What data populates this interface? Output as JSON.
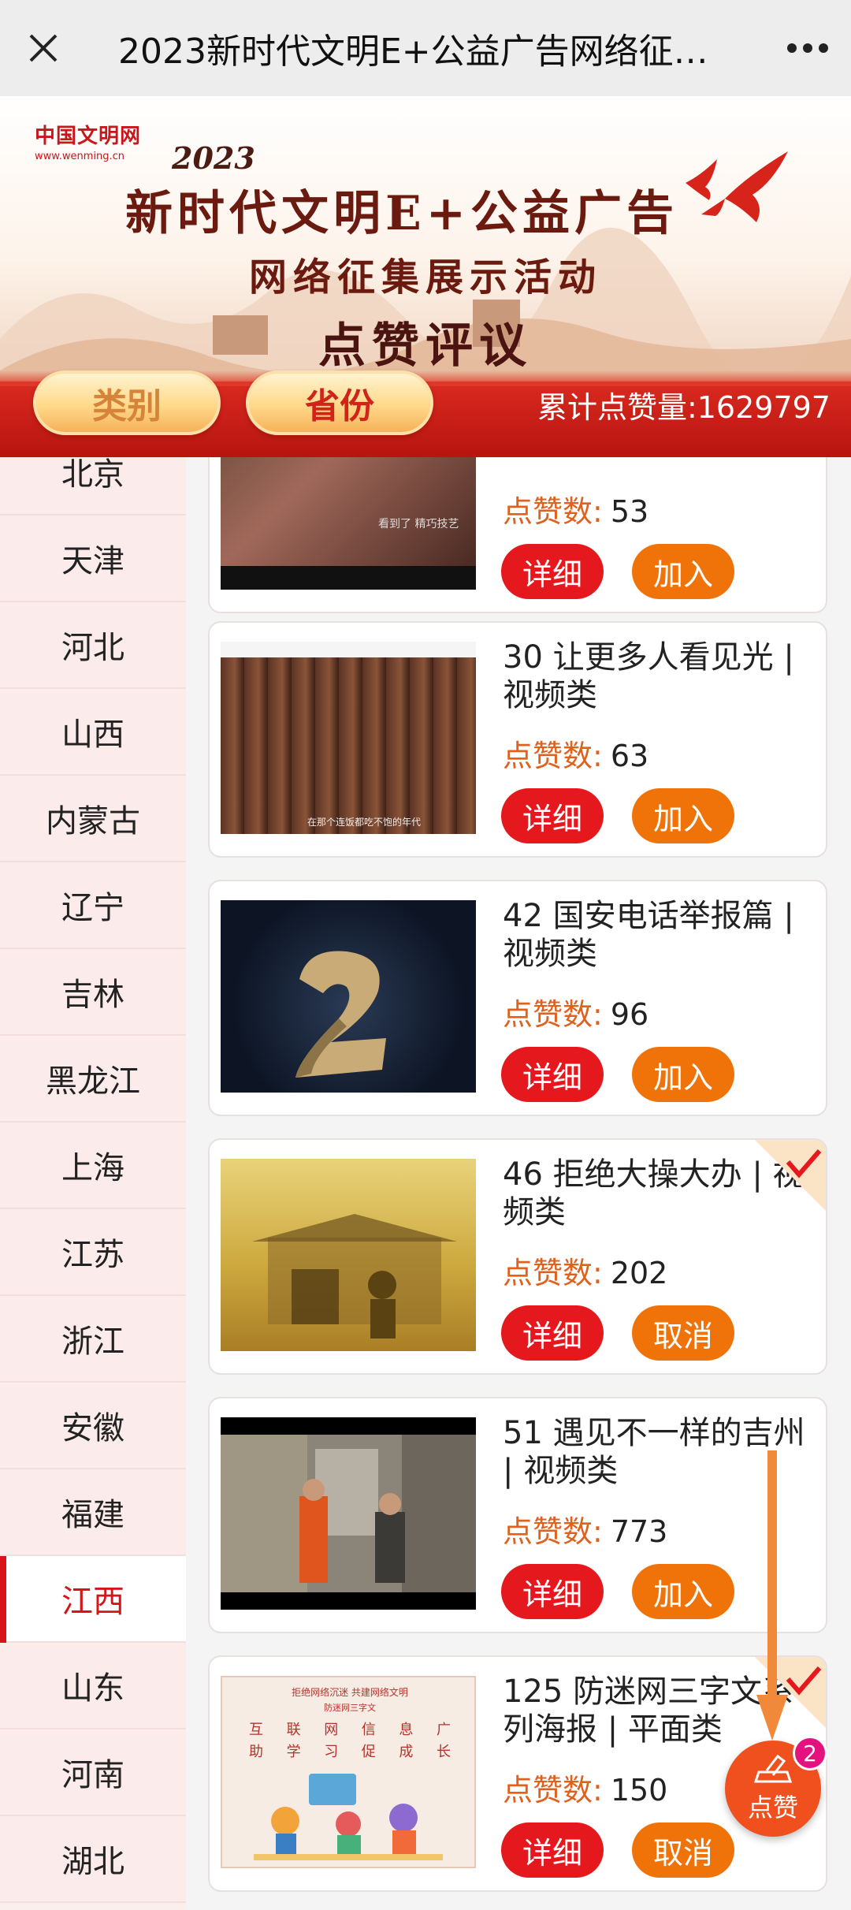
{
  "topbar": {
    "title": "2023新时代文明E+公益广告网络征…"
  },
  "banner": {
    "logo_cn": "中国文明网",
    "logo_en": "www.wenming.cn",
    "year": "2023",
    "line1": "新时代文明E+公益广告",
    "line2": "网络征集展示活动",
    "line3": "点赞评议",
    "tab_category": "类别",
    "tab_province": "省份",
    "total_label": "累计点赞量:",
    "total_value": "1629797"
  },
  "sidebar": {
    "items": [
      "北京",
      "天津",
      "河北",
      "山西",
      "内蒙古",
      "辽宁",
      "吉林",
      "黑龙江",
      "上海",
      "江苏",
      "浙江",
      "安徽",
      "福建",
      "江西",
      "山东",
      "河南",
      "湖北"
    ],
    "active": "江西"
  },
  "cards": [
    {
      "title": "",
      "likes_label": "点赞数:",
      "likes": "53",
      "detail": "详细",
      "action": "加入",
      "checked": false,
      "thumb_caption": "看到了 精巧技艺"
    },
    {
      "title": "30 让更多人看见光 | 视频类",
      "likes_label": "点赞数:",
      "likes": "63",
      "detail": "详细",
      "action": "加入",
      "checked": false,
      "thumb_caption": "在那个连饭都吃不饱的年代"
    },
    {
      "title": "42 国安电话举报篇 | 视频类",
      "likes_label": "点赞数:",
      "likes": "96",
      "detail": "详细",
      "action": "加入",
      "checked": false,
      "thumb_caption": ""
    },
    {
      "title": "46 拒绝大操大办 | 视频类",
      "likes_label": "点赞数:",
      "likes": "202",
      "detail": "详细",
      "action": "取消",
      "checked": true,
      "thumb_caption": ""
    },
    {
      "title": "51 遇见不一样的吉州 | 视频类",
      "likes_label": "点赞数:",
      "likes": "773",
      "detail": "详细",
      "action": "加入",
      "checked": false,
      "thumb_caption": ""
    },
    {
      "title": "125 防迷网三字文系列海报 | 平面类",
      "likes_label": "点赞数:",
      "likes": "150",
      "detail": "详细",
      "action": "取消",
      "checked": true,
      "thumb_caption": ""
    }
  ],
  "poster": {
    "header": "拒绝网络沉迷 共建网络文明",
    "sub": "防迷网三字文",
    "row1": [
      "互",
      "联",
      "网",
      "信",
      "息",
      "广"
    ],
    "row2": [
      "助",
      "学",
      "习",
      "促",
      "成",
      "长"
    ]
  },
  "fab": {
    "label": "点赞",
    "badge": "2"
  },
  "colors": {
    "accent_red": "#e5181d",
    "accent_orange": "#f0730a",
    "likes_label": "#e0601d",
    "fab": "#f0501e",
    "badge": "#e3127e"
  }
}
